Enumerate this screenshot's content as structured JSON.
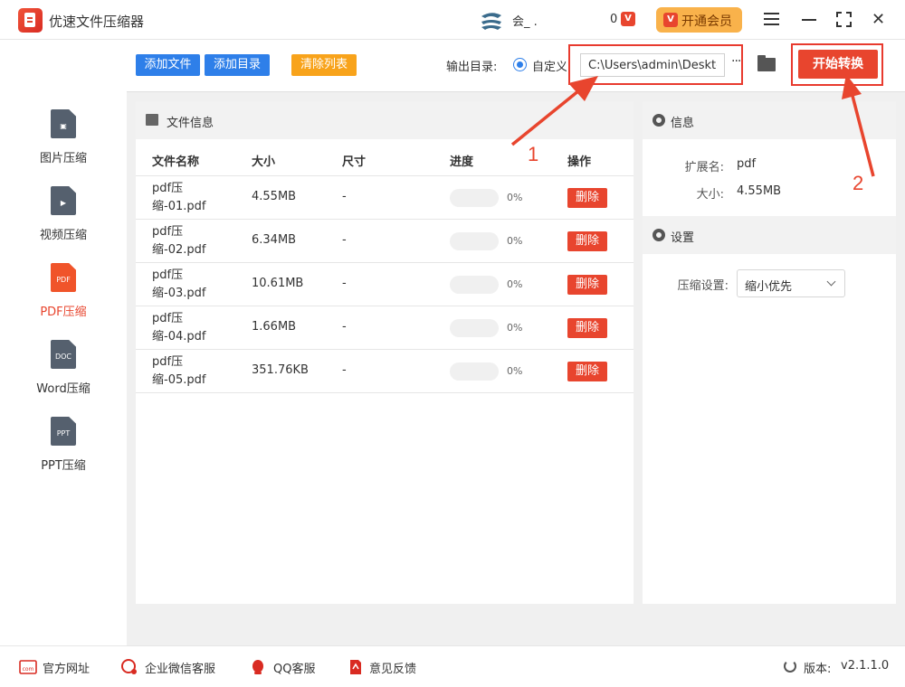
{
  "app": {
    "title": "优速文件压缩器"
  },
  "user": {
    "name": "会_ .",
    "coins": "0"
  },
  "vip": {
    "label": "开通会员"
  },
  "sidebar": {
    "items": [
      {
        "label": "图片压缩",
        "glyph": "▣",
        "active": false
      },
      {
        "label": "视频压缩",
        "glyph": "▶",
        "active": false
      },
      {
        "label": "PDF压缩",
        "glyph": "PDF",
        "active": true
      },
      {
        "label": "Word压缩",
        "glyph": "DOC",
        "active": false
      },
      {
        "label": "PPT压缩",
        "glyph": "PPT",
        "active": false
      }
    ]
  },
  "toolbar": {
    "add_file": "添加文件",
    "add_dir": "添加目录",
    "clear_list": "清除列表",
    "output_label": "输出目录:",
    "custom_label": "自定义",
    "output_path": "C:\\Users\\admin\\Desktop",
    "more": "···",
    "start": "开始转换"
  },
  "files_panel": {
    "title": "文件信息",
    "headers": {
      "name": "文件名称",
      "size": "大小",
      "dim": "尺寸",
      "progress": "进度",
      "action": "操作"
    },
    "rows": [
      {
        "name": "pdf压缩-01.pdf",
        "size": "4.55MB",
        "dim": "-",
        "progress": 0,
        "pct": "0%",
        "action": "删除"
      },
      {
        "name": "pdf压缩-02.pdf",
        "size": "6.34MB",
        "dim": "-",
        "progress": 0,
        "pct": "0%",
        "action": "删除"
      },
      {
        "name": "pdf压缩-03.pdf",
        "size": "10.61MB",
        "dim": "-",
        "progress": 0,
        "pct": "0%",
        "action": "删除"
      },
      {
        "name": "pdf压缩-04.pdf",
        "size": "1.66MB",
        "dim": "-",
        "progress": 0,
        "pct": "0%",
        "action": "删除"
      },
      {
        "name": "pdf压缩-05.pdf",
        "size": "351.76KB",
        "dim": "-",
        "progress": 0,
        "pct": "0%",
        "action": "删除"
      }
    ]
  },
  "info_panel": {
    "title": "信息",
    "ext_label": "扩展名:",
    "ext_value": "pdf",
    "size_label": "大小:",
    "size_value": "4.55MB"
  },
  "settings_panel": {
    "title": "设置",
    "compress_label": "压缩设置:",
    "compress_value": "缩小优先"
  },
  "annotations": {
    "one": "1",
    "two": "2"
  },
  "footer": {
    "website": "官方网址",
    "wechat": "企业微信客服",
    "qq": "QQ客服",
    "feedback": "意见反馈",
    "version_label": "版本:",
    "version": "v2.1.1.0"
  },
  "colors": {
    "accent": "#e8452e",
    "blue": "#2e7fe9",
    "orange": "#f8a31b",
    "vip": "#f9b24b"
  }
}
